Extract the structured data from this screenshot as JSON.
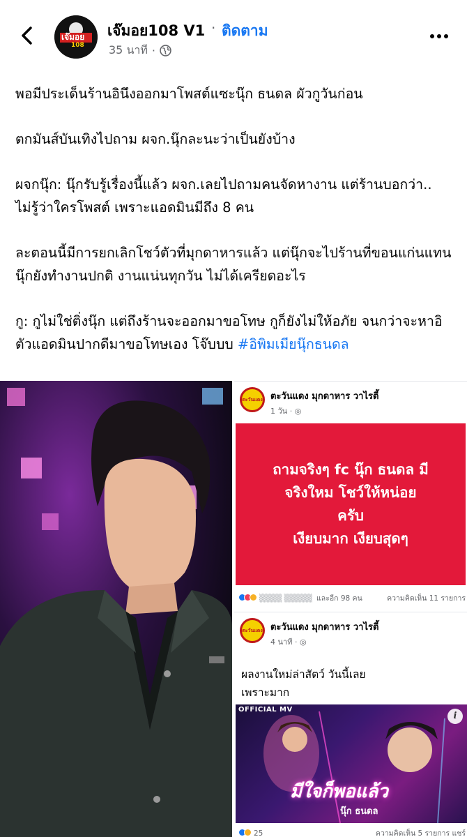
{
  "header": {
    "page_name": "เจ๊มอย108 V1",
    "separator": "·",
    "follow_label": "ติดตาม",
    "post_time": "35 นาที",
    "avatar_text": "เจ๊มอย",
    "avatar_subtext": "108",
    "back_icon": "chevron-left-icon",
    "more_icon": "more-dots-icon",
    "privacy_icon": "globe-icon"
  },
  "post": {
    "paragraphs": [
      "พอมีประเด็นร้านอินึงออกมาโพสต์แซะนุ๊ก ธนดล ผัวกูวันก่อน",
      "ตกมันส์บันเทิงไปถาม ผจก.นุ๊กละนะว่าเป็นยังบ้าง",
      "ผจกนุ๊ก: นุ๊กรับรู้เรื่องนี้แล้ว ผจก.เลยไปถามคนจัดหางาน  แต่ร้านบอกว่า.. ไม่รู้ว่าใครโพสต์ เพราะแอดมินมีถึง 8 คน",
      "ละตอนนี้มีการยกเลิกโชว์ตัวที่มุกดาหารแล้ว แต่นุ๊กจะไปร้านที่ขอนแก่นแทน นุ๊กยังทำงานปกติ งานแน่นทุกวัน ไม่ได้เครียดอะไร"
    ],
    "last_paragraph": "กู: กูไม่ใช่ติ่งนุ๊ก แต่ถึงร้านจะออกมาขอโทษ กูก็ยังไม่ให้อภัย จนกว่าจะหาอิตัวแอดมินปากดีมาขอโทษเอง โจ๊บบบ",
    "hashtag": "#อิพิมเมียนุ๊กธนดล"
  },
  "embed_top": {
    "page_name": "ตะวันแดง มุกดาหาร วาไรตี้",
    "time": "1 วัน",
    "logo_text": "ตะวันแดง",
    "card_lines": [
      "ถามจริงๆ fc นุ๊ก ธนดล มี",
      "จริงใหม โชว์ให้หน่อย",
      "ครับ",
      "เงียบมาก เงียบสุดๆ"
    ],
    "reactions_text": "และอีก 98 คน",
    "comments_text": "ความคิดเห็น 11 รายการ"
  },
  "embed_bottom": {
    "page_name": "ตะวันแดง มุกดาหาร วาไรตี้",
    "time": "4 นาที",
    "logo_text": "ตะวันแดง",
    "text_line1": "ผลงานใหม่ล่าสัตว์ วันนี้เลย",
    "text_line2": "เพราะมาก",
    "mv_label": "OFFICIAL MV",
    "mv_title": "มีใจก็พอแล้ว",
    "mv_artist": "นุ๊ก ธนดล",
    "reaction_count": "25",
    "comments_text": "ความคิดเห็น 5 รายการ แชร์"
  },
  "colors": {
    "brand_blue": "#1877f2",
    "card_red": "#e3193a",
    "meta_gray": "#65676b"
  }
}
